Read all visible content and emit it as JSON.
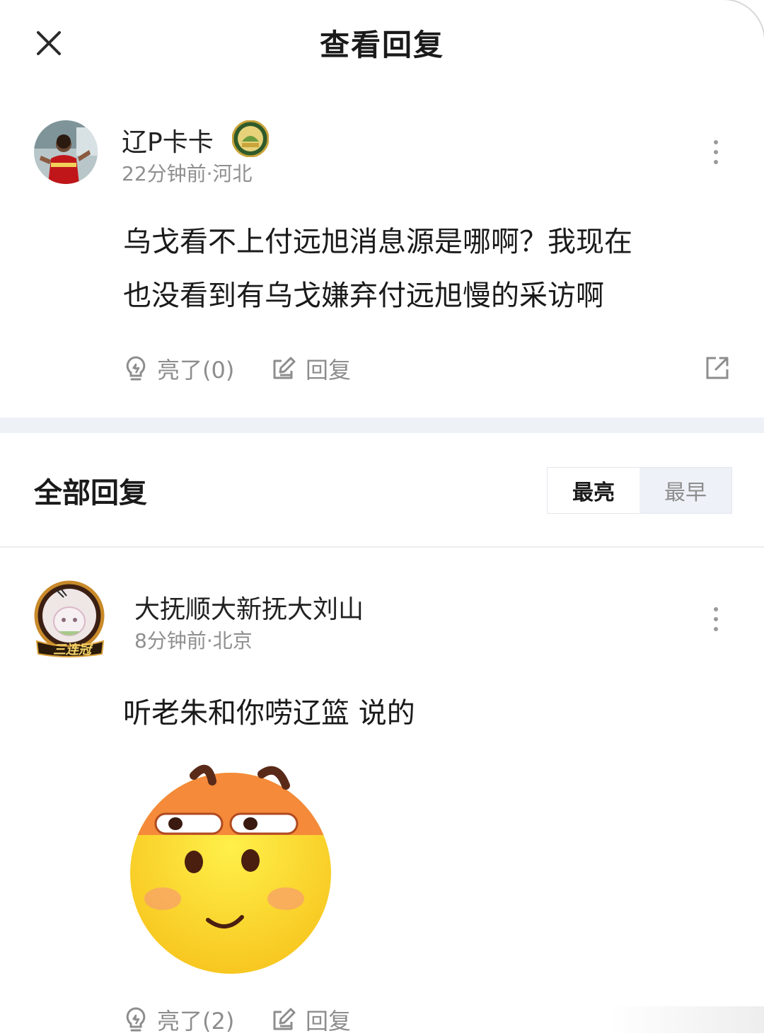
{
  "header": {
    "title": "查看回复",
    "close_icon": "close-icon"
  },
  "original_comment": {
    "username": "辽P卡卡",
    "badge_icon": "badge-icon",
    "meta": "22分钟前·河北",
    "content_line1": "乌戈看不上付远旭消息源是哪啊？我现在",
    "content_line2": "也没看到有乌戈嫌弃付远旭慢的采访啊",
    "like_label": "亮了(0)",
    "reply_label": "回复",
    "share_icon": "share-icon"
  },
  "replies_section": {
    "title": "全部回复",
    "sort_options": [
      "最亮",
      "最早"
    ],
    "selected_sort": "最亮"
  },
  "replies": [
    {
      "username": "大抚顺大新抚大刘山",
      "meta": "8分钟前·北京",
      "avatar_badge_text": "三连冠",
      "content": "听老朱和你唠辽篮 说的",
      "sticker_icon": "smirk-emoji-sticker",
      "like_label": "亮了(2)",
      "reply_label": "回复"
    }
  ],
  "colors": {
    "text_primary": "#1a1a1a",
    "text_secondary": "#8f8f8f",
    "divider": "#eef1f6",
    "sort_inactive_bg": "#eef1f7"
  }
}
